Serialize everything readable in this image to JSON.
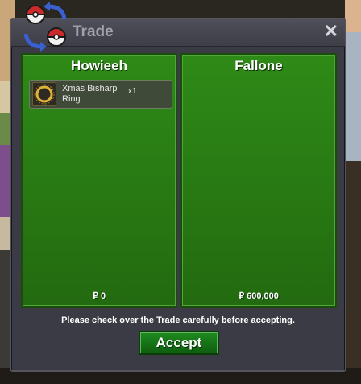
{
  "window": {
    "title": "Trade",
    "close_label": "✕"
  },
  "left_panel": {
    "player": "Howieeh",
    "money": "₽ 0",
    "items": [
      {
        "name": "Xmas Bisharp Ring",
        "quantity": "x1",
        "icon": "ring-icon"
      }
    ]
  },
  "right_panel": {
    "player": "Fallone",
    "money": "₽ 600,000",
    "items": []
  },
  "notice": "Please check over the Trade carefully before accepting.",
  "accept_label": "Accept",
  "colors": {
    "panel_green": "#2e8a17",
    "window_bg": "#3b3b46",
    "accept_green": "#1f8a1f"
  }
}
